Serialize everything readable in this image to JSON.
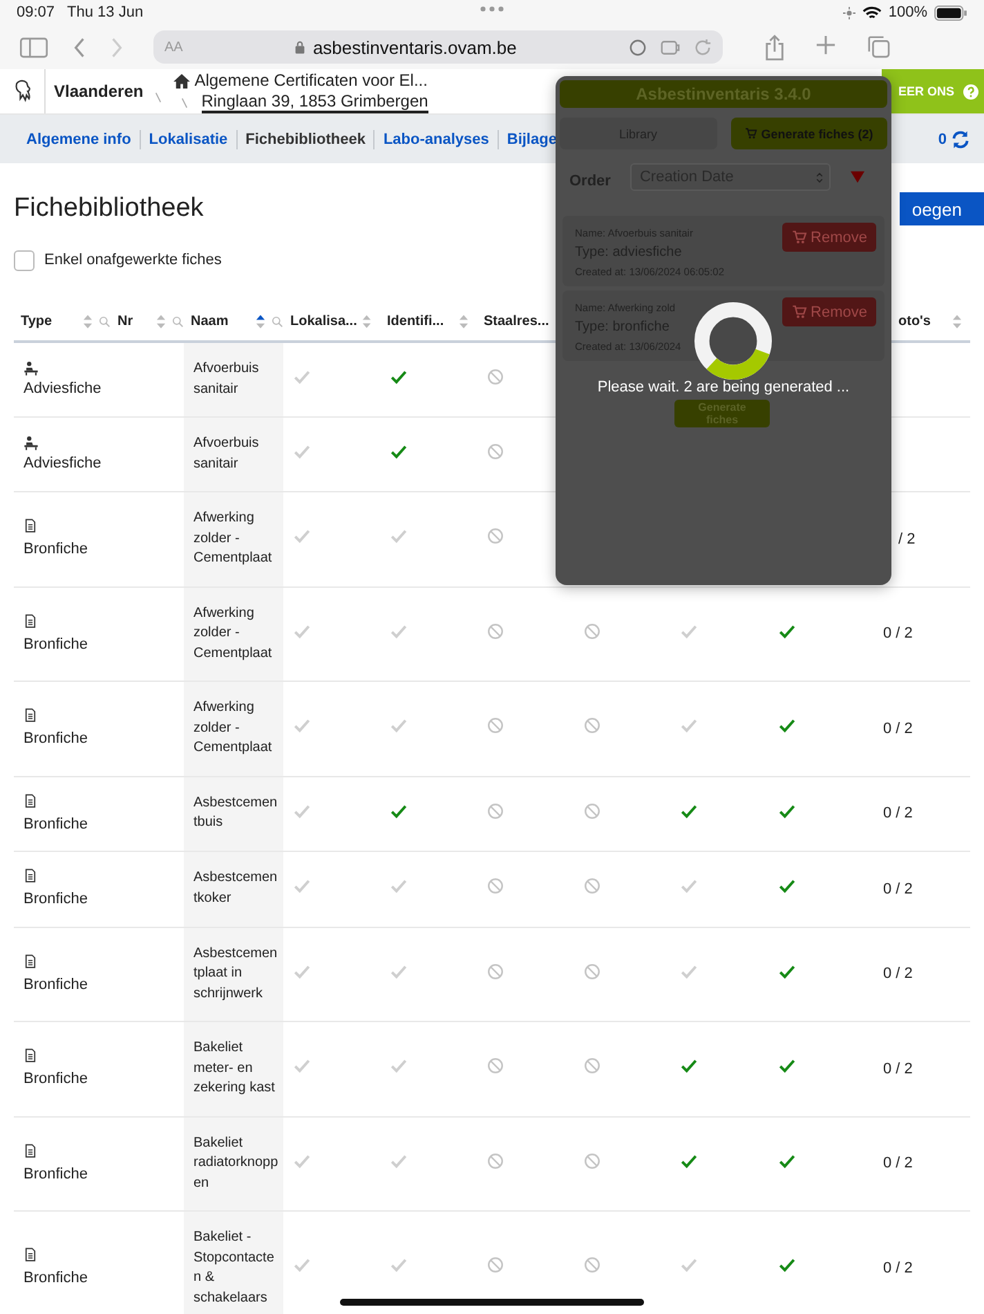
{
  "status_bar": {
    "time": "09:07",
    "date": "Thu 13 Jun",
    "battery": "100%"
  },
  "browser": {
    "text_size": "AA",
    "url": "asbestinventaris.ovam.be"
  },
  "site": {
    "brand": "Vlaanderen",
    "breadcrumb": "Algemene Certificaten voor El...",
    "address": "Ringlaan 39, 1853 Grimbergen",
    "contact": "EER ONS"
  },
  "nav": {
    "tabs": [
      {
        "label": "Algemene info",
        "selected": false
      },
      {
        "label": "Lokalisatie",
        "selected": false
      },
      {
        "label": "Fichebibliotheek",
        "selected": true
      },
      {
        "label": "Labo-analyses",
        "selected": false
      },
      {
        "label": "Bijlage",
        "selected": false
      }
    ],
    "count": "0"
  },
  "page": {
    "title": "Fichebibliotheek",
    "add_button": "oegen",
    "filter": {
      "label": "Enkel onafgewerkte fiches",
      "checked": false
    }
  },
  "table": {
    "columns": [
      {
        "label": "Type",
        "sorted": false,
        "search": true
      },
      {
        "label": "Nr",
        "sorted": false,
        "search": true
      },
      {
        "label": "Naam",
        "sorted": true,
        "search": true
      },
      {
        "label": "Lokalisa...",
        "sorted": false,
        "search": false
      },
      {
        "label": "Identifi...",
        "sorted": false,
        "search": false
      },
      {
        "label": "Staalres...",
        "search": false
      },
      null,
      null,
      null,
      {
        "label": "oto's",
        "sorted": false,
        "search": false
      }
    ],
    "rows": [
      {
        "kind": "advies",
        "type": "Adviesfiche",
        "name": "Afvoerbuis sanitair",
        "cells": [
          {
            "kind": "check",
            "checked": false
          },
          {
            "kind": "check",
            "checked": true
          },
          {
            "kind": "na"
          },
          null,
          null,
          null
        ]
      },
      {
        "kind": "advies",
        "type": "Adviesfiche",
        "name": "Afvoerbuis sanitair",
        "cells": [
          {
            "kind": "check",
            "checked": false
          },
          {
            "kind": "check",
            "checked": true
          },
          {
            "kind": "na"
          },
          null,
          null,
          null
        ]
      },
      {
        "kind": "bron",
        "type": "Bronfiche",
        "name": "Afwerking zolder - Cementplaat",
        "cells": [
          {
            "kind": "check",
            "checked": false
          },
          {
            "kind": "check",
            "checked": false
          },
          {
            "kind": "na"
          },
          null,
          null,
          null
        ],
        "photos": "/ 2"
      },
      {
        "kind": "bron",
        "type": "Bronfiche",
        "name": "Afwerking zolder - Cementplaat",
        "cells": [
          {
            "kind": "check",
            "checked": false
          },
          {
            "kind": "check",
            "checked": false
          },
          {
            "kind": "na"
          },
          {
            "kind": "na"
          },
          {
            "kind": "check",
            "checked": false
          },
          {
            "kind": "check",
            "checked": true
          }
        ],
        "photos": "0 / 2"
      },
      {
        "kind": "bron",
        "type": "Bronfiche",
        "name": "Afwerking zolder - Cementplaat",
        "cells": [
          {
            "kind": "check",
            "checked": false
          },
          {
            "kind": "check",
            "checked": false
          },
          {
            "kind": "na"
          },
          {
            "kind": "na"
          },
          {
            "kind": "check",
            "checked": false
          },
          {
            "kind": "check",
            "checked": true
          }
        ],
        "photos": "0 / 2"
      },
      {
        "kind": "bron",
        "type": "Bronfiche",
        "name": "Asbestcementbuis",
        "cells": [
          {
            "kind": "check",
            "checked": false
          },
          {
            "kind": "check",
            "checked": true
          },
          {
            "kind": "na"
          },
          {
            "kind": "na"
          },
          {
            "kind": "check",
            "checked": true
          },
          {
            "kind": "check",
            "checked": true
          }
        ],
        "photos": "0 / 2"
      },
      {
        "kind": "bron",
        "type": "Bronfiche",
        "name": "Asbestcementkoker",
        "cells": [
          {
            "kind": "check",
            "checked": false
          },
          {
            "kind": "check",
            "checked": false
          },
          {
            "kind": "na"
          },
          {
            "kind": "na"
          },
          {
            "kind": "check",
            "checked": false
          },
          {
            "kind": "check",
            "checked": true
          }
        ],
        "photos": "0 / 2"
      },
      {
        "kind": "bron",
        "type": "Bronfiche",
        "name": "Asbestcementplaat in schrijnwerk",
        "cells": [
          {
            "kind": "check",
            "checked": false
          },
          {
            "kind": "check",
            "checked": false
          },
          {
            "kind": "na"
          },
          {
            "kind": "na"
          },
          {
            "kind": "check",
            "checked": false
          },
          {
            "kind": "check",
            "checked": true
          }
        ],
        "photos": "0 / 2"
      },
      {
        "kind": "bron",
        "type": "Bronfiche",
        "name": "Bakeliet meter- en zekering kast",
        "cells": [
          {
            "kind": "check",
            "checked": false
          },
          {
            "kind": "check",
            "checked": false
          },
          {
            "kind": "na"
          },
          {
            "kind": "na"
          },
          {
            "kind": "check",
            "checked": true
          },
          {
            "kind": "check",
            "checked": true
          }
        ],
        "photos": "0 / 2"
      },
      {
        "kind": "bron",
        "type": "Bronfiche",
        "name": "Bakeliet radiatorknoppen",
        "cells": [
          {
            "kind": "check",
            "checked": false
          },
          {
            "kind": "check",
            "checked": false
          },
          {
            "kind": "na"
          },
          {
            "kind": "na"
          },
          {
            "kind": "check",
            "checked": true
          },
          {
            "kind": "check",
            "checked": true
          }
        ],
        "photos": "0 / 2"
      },
      {
        "kind": "bron",
        "type": "Bronfiche",
        "name": "Bakeliet - Stopcontacten & schakelaars",
        "cells": [
          {
            "kind": "check",
            "checked": false
          },
          {
            "kind": "check",
            "checked": false
          },
          {
            "kind": "na"
          },
          {
            "kind": "na"
          },
          {
            "kind": "check",
            "checked": false
          },
          {
            "kind": "check",
            "checked": true
          }
        ],
        "photos": "0 / 2"
      }
    ]
  },
  "popup": {
    "title": "Asbestinventaris 3.4.0",
    "tabs": [
      {
        "label": "Library",
        "selected": false
      },
      {
        "label": "Generate fiches (2)",
        "selected": true
      }
    ],
    "order_label": "Order",
    "order_value": "Creation Date",
    "descending": true,
    "items": [
      {
        "name": "Name: Afvoerbuis sanitair",
        "type": "Type: adviesfiche",
        "created": "Created at: 13/06/2024 06:05:02",
        "button": "Remove"
      },
      {
        "name": "Name: Afwerking zold",
        "type": "Type: bronfiche",
        "created": "Created at: 13/06/2024",
        "button": "Remove"
      }
    ],
    "message": "Please wait. 2 are being generated ...",
    "generate_button": "Generate fiches"
  }
}
